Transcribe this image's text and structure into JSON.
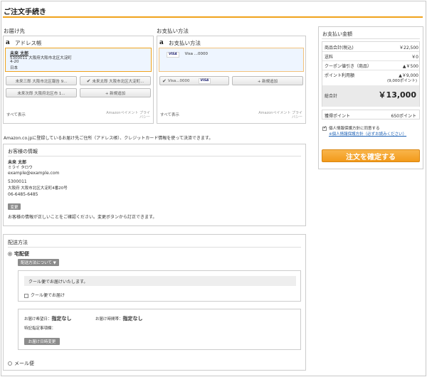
{
  "page": {
    "title": "ご注文手続き"
  },
  "address": {
    "section_label": "お届け先",
    "widget_title": "アドレス帳",
    "selected": {
      "name": "未来 太郎",
      "line1": "5300011 大阪府大阪市北区大淀町",
      "line2": "4-20",
      "line3": "日本"
    },
    "buttons": [
      {
        "label": "未来三郎 大阪市北区報告 9...",
        "checked": false
      },
      {
        "label": "未来太郎 大阪市北区大淀町...",
        "checked": true
      },
      {
        "label": "未来次郎 大阪府北区市 1...",
        "checked": false
      },
      {
        "label": "+ 新規追加",
        "checked": false
      }
    ],
    "show_all": "すべて表示",
    "amazon_note": "Amazonペイメント プライバシー"
  },
  "payment": {
    "section_label": "お支払い方法",
    "widget_title": "お支払い方法",
    "selected": {
      "brand": "VISA",
      "label": "Visa ...0000"
    },
    "card_button": {
      "label": "Visa...0000",
      "brand": "VISA"
    },
    "add_button": "+ 新規追加",
    "show_all": "すべて表示",
    "amazon_note": "Amazonペイメント プライバシー"
  },
  "amazon_notice": "Amazon.co.jpに登録しているお届け先ご住所（アドレス帳）、クレジットカード情報を使って決済できます。",
  "customer": {
    "section_label": "お客様の情報",
    "name": "未来 太郎",
    "kana": "ミライ タロウ",
    "email": "example@example.com",
    "zip": "5300011",
    "address": "大阪府 大阪市北区大淀町4番20号",
    "phone": "06-6485-6485",
    "change_button": "変更",
    "note": "お客様の情報が正しいことをご確認ください。変更ボタンから訂正できます。"
  },
  "shipping": {
    "section_label": "配送方法",
    "option_takkyu": "宅配便",
    "about_button": "配送方法について ▼",
    "cool_notice": "クール便でお届けいたします。",
    "cool_checkbox": "クール便でお届け",
    "date_label": "お届け希望日：",
    "date_value": "指定なし",
    "time_label": "お届け時間帯：",
    "time_value": "指定なし",
    "memo_label": "特記指定事項欄：",
    "change_button": "お届け日時変更",
    "option_mail": "メール便"
  },
  "summary": {
    "title": "お支払い金額",
    "rows": [
      {
        "label": "商品合計(税込)",
        "value": "￥22,500"
      },
      {
        "label": "送料",
        "value": "￥0"
      },
      {
        "label": "クーポン値引き（商品）",
        "value": "▲￥500"
      },
      {
        "label": "ポイント利用額",
        "value": "▲￥9,000"
      }
    ],
    "points_sub": "(9,000ポイント)",
    "total_label": "総合計",
    "total_value": "￥13,000",
    "earned_label": "獲得ポイント",
    "earned_value": "650ポイント",
    "agree_label": "個人情報保護方針に同意する",
    "agree_link": "※個人情報保護方針（必ずお読みください）",
    "confirm_button": "注文を確定する"
  }
}
